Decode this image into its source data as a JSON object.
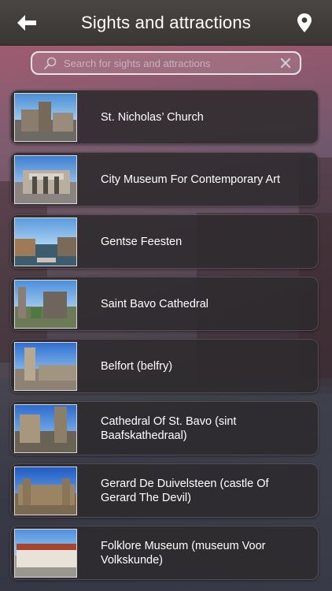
{
  "header": {
    "title": "Sights and attractions",
    "back_icon": "arrow-left-icon",
    "location_icon": "map-pin-icon"
  },
  "search": {
    "placeholder": "Search for sights and attractions",
    "value": "",
    "search_icon": "search-icon",
    "clear_icon": "close-icon"
  },
  "items": [
    {
      "label": "St. Nicholas’ Church"
    },
    {
      "label": "City Museum For Contemporary Art"
    },
    {
      "label": "Gentse Feesten"
    },
    {
      "label": "Saint Bavo Cathedral"
    },
    {
      "label": "Belfort (belfry)"
    },
    {
      "label": "Cathedral Of St. Bavo (sint Baafskathedraal)"
    },
    {
      "label": "Gerard De Duivelsteen (castle Of Gerard The Devil)"
    },
    {
      "label": "Folklore Museum (museum Voor Volkskunde)"
    }
  ],
  "colors": {
    "header_bg": "#3f3b39",
    "item_bg": "#2e2a2e",
    "text": "#ffffff",
    "search_border": "#e9e3e6"
  }
}
